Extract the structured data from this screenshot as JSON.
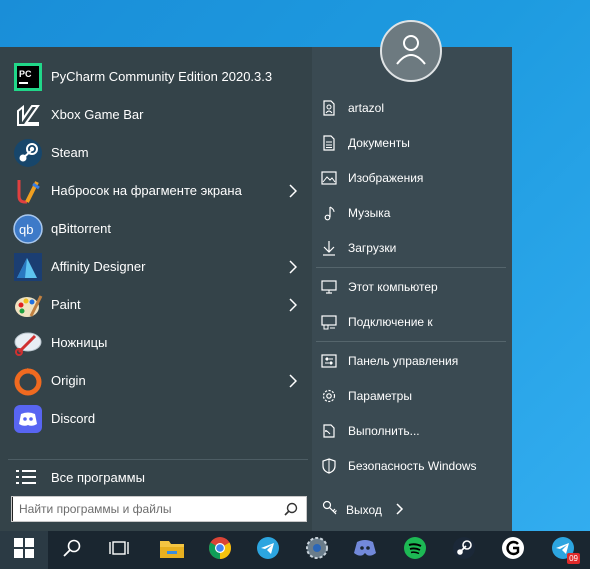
{
  "start_menu": {
    "apps": [
      {
        "label": "PyCharm Community Edition 2020.3.3",
        "icon": "pycharm-icon",
        "has_submenu": false
      },
      {
        "label": "Xbox Game Bar",
        "icon": "xbox-game-bar-icon",
        "has_submenu": false
      },
      {
        "label": "Steam",
        "icon": "steam-icon",
        "has_submenu": false
      },
      {
        "label": "Набросок на фрагменте экрана",
        "icon": "snip-sketch-icon",
        "has_submenu": true
      },
      {
        "label": "qBittorrent",
        "icon": "qbittorrent-icon",
        "has_submenu": false
      },
      {
        "label": "Affinity Designer",
        "icon": "affinity-designer-icon",
        "has_submenu": true
      },
      {
        "label": "Paint",
        "icon": "paint-icon",
        "has_submenu": true
      },
      {
        "label": "Ножницы",
        "icon": "snipping-tool-icon",
        "has_submenu": false
      },
      {
        "label": "Origin",
        "icon": "origin-icon",
        "has_submenu": true
      },
      {
        "label": "Discord",
        "icon": "discord-icon",
        "has_submenu": false
      }
    ],
    "all_programs": "Все программы",
    "search": {
      "placeholder": "Найти программы и файлы",
      "value": ""
    },
    "places": {
      "user": "artazol",
      "documents": "Документы",
      "pictures": "Изображения",
      "music": "Музыка",
      "downloads": "Загрузки",
      "this_pc": "Этот компьютер",
      "connect": "Подключение к",
      "control_panel": "Панель управления",
      "settings": "Параметры",
      "run": "Выполнить...",
      "security": "Безопасность Windows"
    },
    "logout": "Выход"
  },
  "taskbar": {
    "items": [
      "start-icon",
      "search-icon",
      "task-view-icon",
      "file-explorer-icon",
      "chrome-icon",
      "telegram-icon",
      "steam-settings-icon",
      "discord-icon",
      "spotify-icon",
      "steam-icon",
      "logitech-g-hub-icon",
      "telegram-icon"
    ],
    "telegram_badge": "09"
  },
  "colors": {
    "panel_right": "#3a4a52",
    "panel_left": "#344349",
    "taskbar": "#1a2630",
    "desktop": "#1e9be0"
  }
}
